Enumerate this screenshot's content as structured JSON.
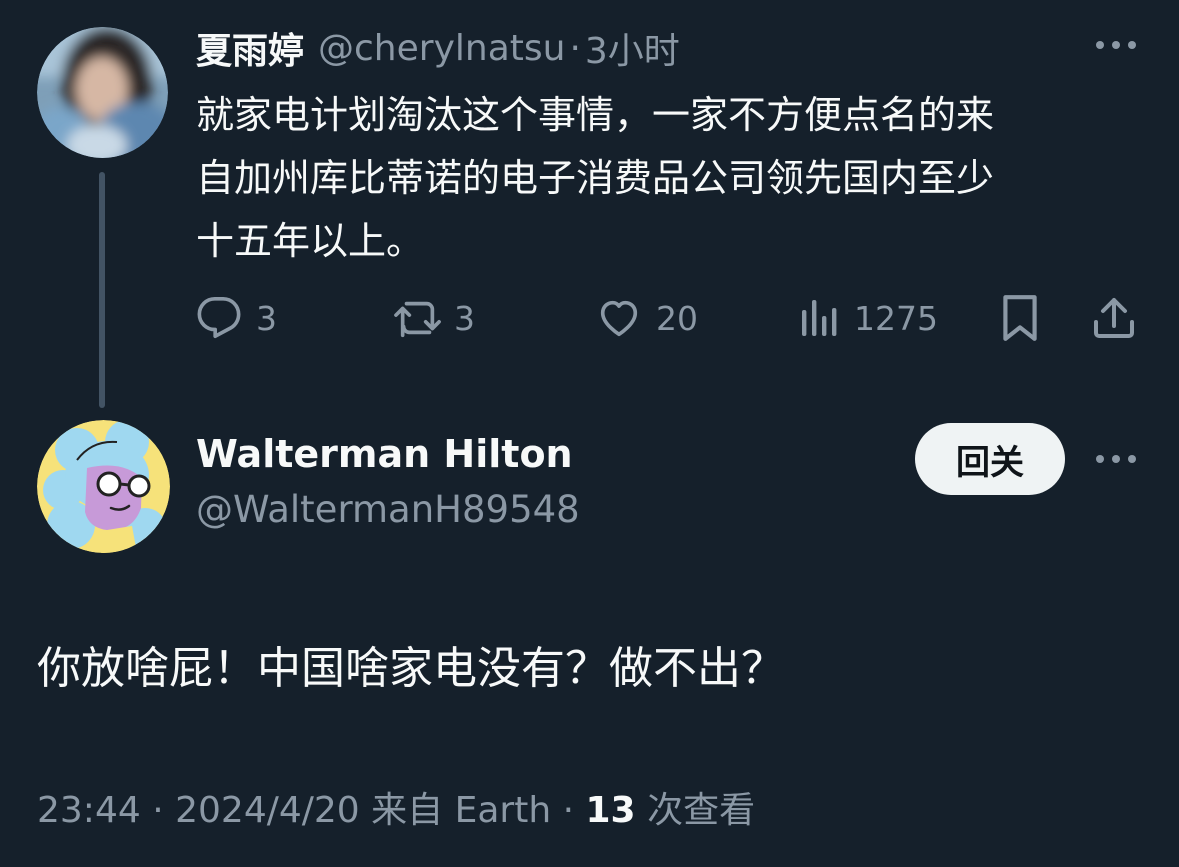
{
  "parent_tweet": {
    "author_name": "夏雨婷",
    "handle": "@cherylnatsu",
    "separator": "·",
    "time_ago": "3小时",
    "text_lines": [
      "就家电计划淘汰这个事情，一家不方便点名的来",
      "自加州库比蒂诺的电子消费品公司领先国内至少",
      "十五年以上。"
    ],
    "actions": {
      "replies": "3",
      "retweets": "3",
      "likes": "20",
      "views": "1275"
    }
  },
  "reply": {
    "author_name": "Walterman Hilton",
    "handle": "@WaltermanH89548",
    "follow_label": "回关",
    "text": "你放啥屁！中国啥家电没有？做不出？",
    "meta": {
      "time": "23:44",
      "sep1": "·",
      "date": "2024/4/20",
      "source": "来自 Earth",
      "sep2": "·",
      "views_count": "13",
      "views_label": "次查看"
    }
  },
  "icons": [
    "more-icon",
    "reply-icon",
    "retweet-icon",
    "like-icon",
    "views-icon",
    "bookmark-icon",
    "share-icon"
  ],
  "colors": {
    "background": "#15202b",
    "text": "#f7f9f9",
    "muted": "#8b98a5",
    "thread_line": "#425364",
    "button_bg": "#eff3f4"
  }
}
